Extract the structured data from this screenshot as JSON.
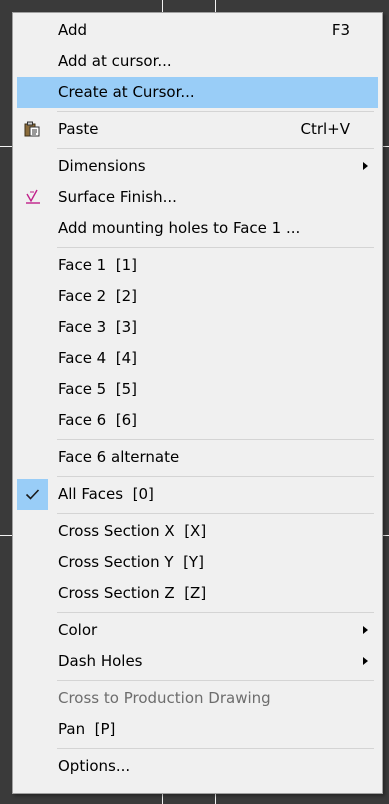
{
  "menu": {
    "items": [
      {
        "label": "Add",
        "shortcut": "F3"
      },
      {
        "label": "Add at cursor..."
      },
      {
        "label": "Create at Cursor...",
        "state": "highlighted"
      },
      {
        "label": "Paste",
        "shortcut": "Ctrl+V",
        "icon": "clipboard-icon"
      },
      {
        "label": "Dimensions",
        "submenu": true
      },
      {
        "label": "Surface Finish...",
        "icon": "surface-finish-icon"
      },
      {
        "label": "Add mounting holes to Face 1 ..."
      },
      {
        "label": "Face 1  [1]"
      },
      {
        "label": "Face 2  [2]"
      },
      {
        "label": "Face 3  [3]"
      },
      {
        "label": "Face 4  [4]"
      },
      {
        "label": "Face 5  [5]"
      },
      {
        "label": "Face 6  [6]"
      },
      {
        "label": "Face 6 alternate"
      },
      {
        "label": "All Faces  [0]",
        "checked": true,
        "icon": "checkmark-icon"
      },
      {
        "label": "Cross Section X  [X]"
      },
      {
        "label": "Cross Section Y  [Y]"
      },
      {
        "label": "Cross Section Z  [Z]"
      },
      {
        "label": "Color",
        "submenu": true
      },
      {
        "label": "Dash Holes",
        "submenu": true
      },
      {
        "label": "Cross to Production Drawing",
        "disabled": true
      },
      {
        "label": "Pan  [P]"
      },
      {
        "label": "Options..."
      }
    ]
  },
  "colors": {
    "menu_background": "#f0f0f0",
    "highlight": "#99cdf7",
    "disabled_text": "#6d6d6d",
    "canvas_background": "#3a3a3a"
  }
}
